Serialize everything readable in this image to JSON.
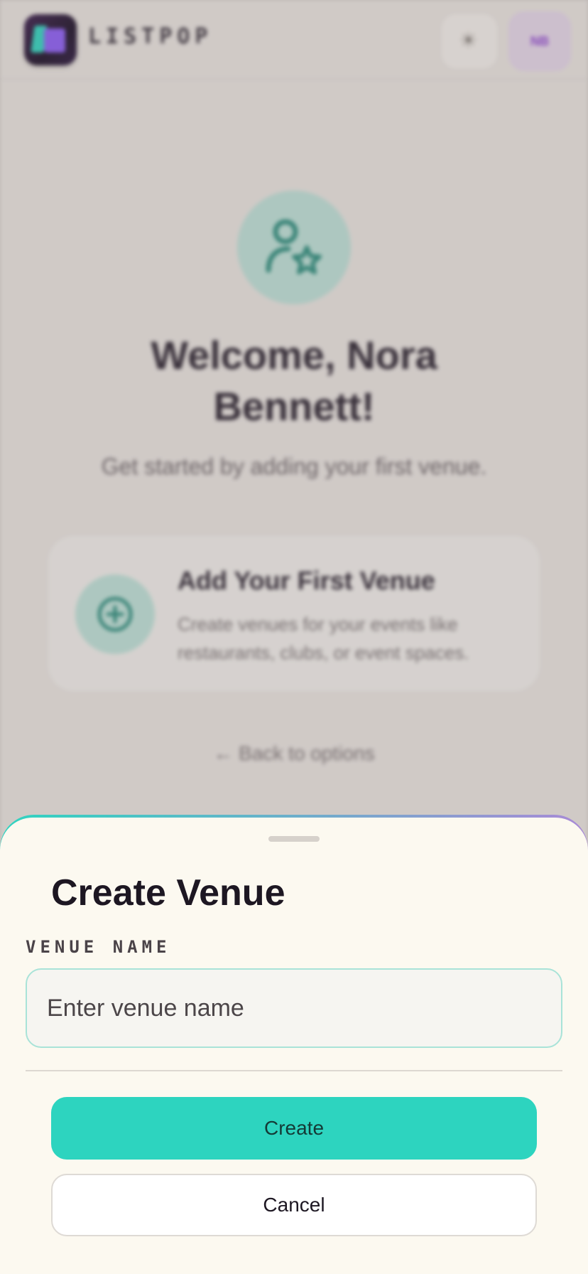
{
  "header": {
    "brand": "LISTPOP",
    "logo_icon": "listpop-logo",
    "theme_icon": "sun-icon",
    "avatar_initials": "NB"
  },
  "welcome": {
    "icon": "user-star-icon",
    "title": "Welcome, Nora Bennett!",
    "subtitle": "Get started by adding your first venue."
  },
  "venue_card": {
    "icon": "plus-circle-icon",
    "title": "Add Your First Venue",
    "description": "Create venues for your events like restaurants, clubs, or event spaces."
  },
  "back_link": "← Back to options",
  "sheet": {
    "title": "Create Venue",
    "field_label": "VENUE NAME",
    "input_placeholder": "Enter venue name",
    "input_value": "",
    "create_label": "Create",
    "cancel_label": "Cancel"
  },
  "colors": {
    "accent": "#2dd4bf",
    "brand_purple": "#8b5cf6",
    "sheet_bg": "#fcf9f0"
  }
}
